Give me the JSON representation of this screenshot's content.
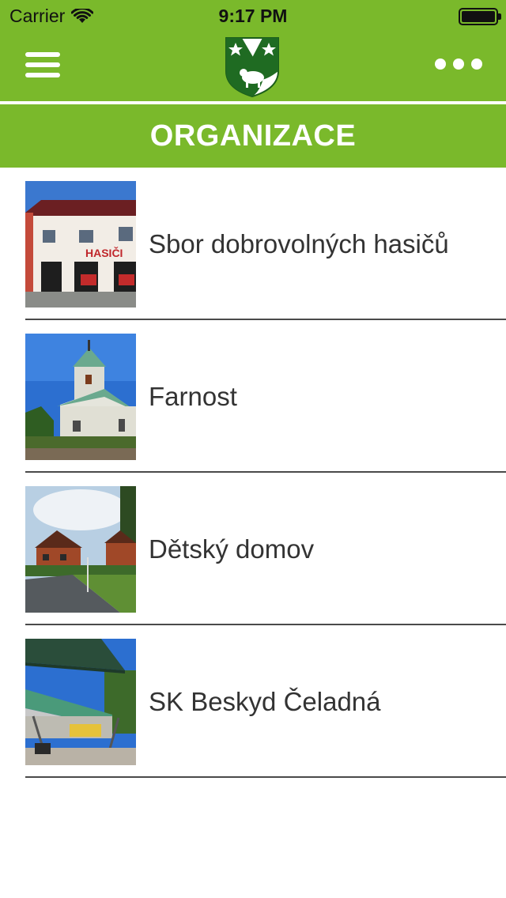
{
  "status_bar": {
    "carrier": "Carrier",
    "time": "9:17 PM"
  },
  "nav": {
    "menu_icon": "hamburger-icon",
    "logo_icon": "coat-of-arms-lamb-icon",
    "more_icon": "more-dots-icon"
  },
  "title": "ORGANIZACE",
  "colors": {
    "accent": "#7ab92b",
    "text": "#333333"
  },
  "items": [
    {
      "label": "Sbor dobrovolných hasičů",
      "thumb": "fire-station-photo"
    },
    {
      "label": "Farnost",
      "thumb": "church-photo"
    },
    {
      "label": "Dětský domov",
      "thumb": "childrens-home-photo"
    },
    {
      "label": "SK Beskyd Čeladná",
      "thumb": "stadium-grandstand-photo"
    }
  ]
}
